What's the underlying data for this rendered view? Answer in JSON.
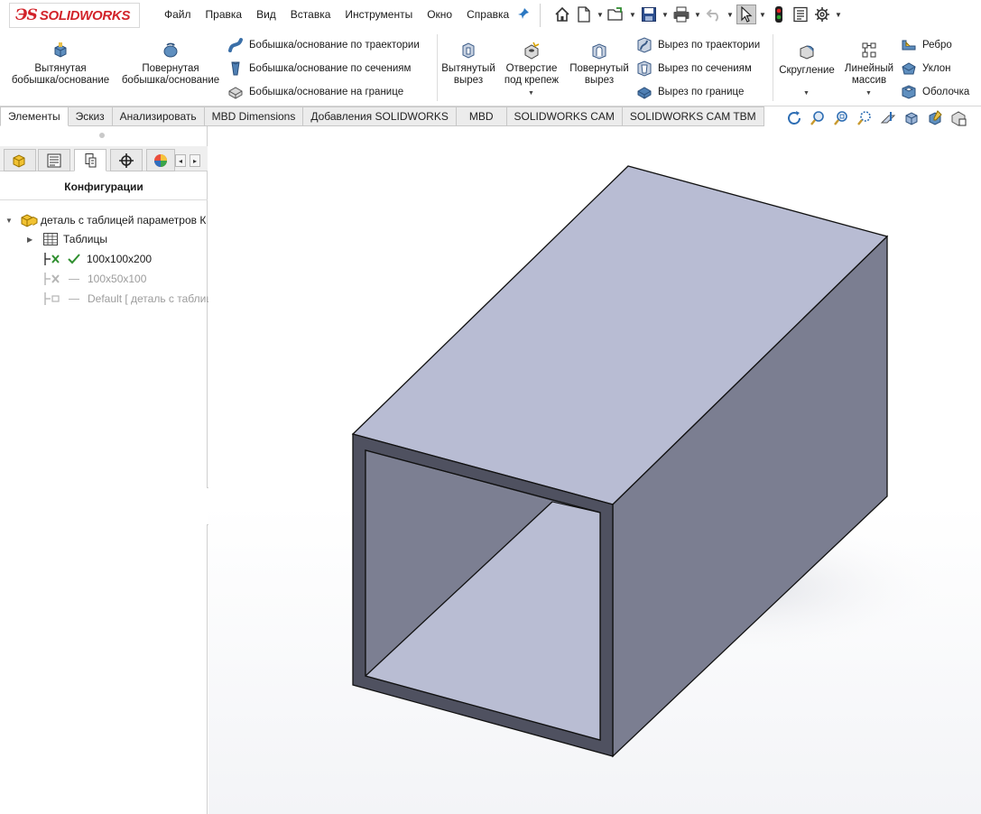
{
  "app": {
    "logo_ds": "3DS",
    "logo_text": "SOLIDWORKS"
  },
  "menu": [
    "Файл",
    "Правка",
    "Вид",
    "Вставка",
    "Инструменты",
    "Окно",
    "Справка"
  ],
  "quick_access": [
    "home-icon",
    "new-document-icon",
    "open-icon",
    "save-icon",
    "print-icon",
    "undo-icon",
    "select-icon",
    "traffic-light-icon",
    "file-properties-icon",
    "options-gear-icon"
  ],
  "ribbon": {
    "extruded_boss_l1": "Вытянутая",
    "extruded_boss_l2": "бобышка/основание",
    "revolved_boss_l1": "Повернутая",
    "revolved_boss_l2": "бобышка/основание",
    "swept_boss": "Бобышка/основание по траектории",
    "lofted_boss": "Бобышка/основание по сечениям",
    "boundary_boss": "Бобышка/основание на границе",
    "extruded_cut_l1": "Вытянутый",
    "extruded_cut_l2": "вырез",
    "hole_wizard_l1": "Отверстие",
    "hole_wizard_l2": "под крепеж",
    "revolved_cut_l1": "Повернутый",
    "revolved_cut_l2": "вырез",
    "swept_cut": "Вырез по траектории",
    "lofted_cut": "Вырез по сечениям",
    "boundary_cut": "Вырез по границе",
    "fillet": "Скругление",
    "linear_pattern_l1": "Линейный",
    "linear_pattern_l2": "массив",
    "rib": "Ребро",
    "draft": "Уклон",
    "shell": "Оболочка"
  },
  "tabs": [
    "Элементы",
    "Эскиз",
    "Анализировать",
    "MBD Dimensions",
    "Добавления SOLIDWORKS",
    "MBD",
    "SOLIDWORKS CAM",
    "SOLIDWORKS CAM TBM"
  ],
  "active_tab": "Элементы",
  "panel": {
    "title": "Конфигурации",
    "root_label": "деталь с таблицей параметров К",
    "tables_label": "Таблицы",
    "configs": [
      {
        "name": "100x100x200",
        "active": true
      },
      {
        "name": "100x50x100",
        "active": false
      },
      {
        "name": "Default [ деталь с таблиц",
        "active": false
      }
    ]
  },
  "colors": {
    "brand_red": "#d2232a",
    "top_face": "#b8bcd3",
    "side_face": "#7b7e91",
    "front_face": "#4f5160",
    "inner_floor": "#b9bdd3",
    "inner_wall": "#7c7f92",
    "check_green": "#2f8f2f"
  }
}
